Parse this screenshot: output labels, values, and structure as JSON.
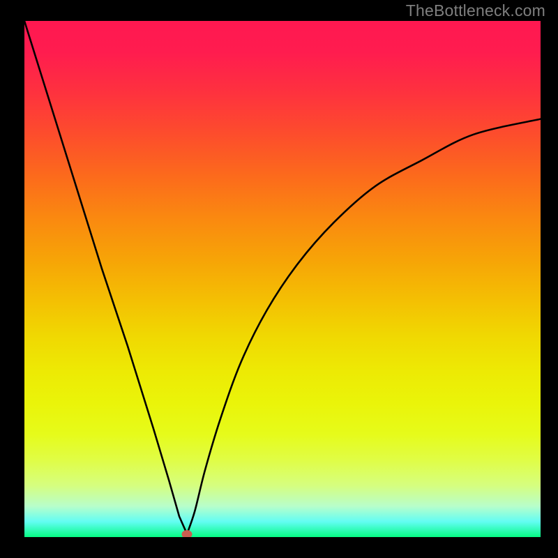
{
  "watermark": "TheBottleneck.com",
  "chart_data": {
    "type": "line",
    "title": "",
    "xlabel": "",
    "ylabel": "",
    "xlim": [
      0,
      100
    ],
    "ylim": [
      0,
      100
    ],
    "grid": false,
    "legend": false,
    "background": {
      "style": "gradient",
      "colors_top_to_bottom": [
        "#ff1850",
        "#f4bf03",
        "#edea04",
        "#06fc85"
      ]
    },
    "curve": {
      "description": "V-shaped bottleneck curve with vertex near the minimum",
      "vertex": {
        "x": 31.5,
        "y": 0.6
      },
      "left_intercept_y_at_x0": 100,
      "right_value_at_x100": 81,
      "series": [
        {
          "x": 0,
          "y": 100
        },
        {
          "x": 5,
          "y": 84
        },
        {
          "x": 10,
          "y": 68
        },
        {
          "x": 15,
          "y": 52
        },
        {
          "x": 20,
          "y": 37
        },
        {
          "x": 25,
          "y": 21
        },
        {
          "x": 28,
          "y": 11
        },
        {
          "x": 30,
          "y": 4
        },
        {
          "x": 31.5,
          "y": 0.6
        },
        {
          "x": 33,
          "y": 5
        },
        {
          "x": 35,
          "y": 13
        },
        {
          "x": 38,
          "y": 23
        },
        {
          "x": 42,
          "y": 34
        },
        {
          "x": 47,
          "y": 44
        },
        {
          "x": 53,
          "y": 53
        },
        {
          "x": 60,
          "y": 61
        },
        {
          "x": 68,
          "y": 68
        },
        {
          "x": 77,
          "y": 73
        },
        {
          "x": 87,
          "y": 78
        },
        {
          "x": 100,
          "y": 81
        }
      ]
    },
    "marker": {
      "x": 31.5,
      "y": 0.6,
      "color": "#c95e51"
    }
  }
}
